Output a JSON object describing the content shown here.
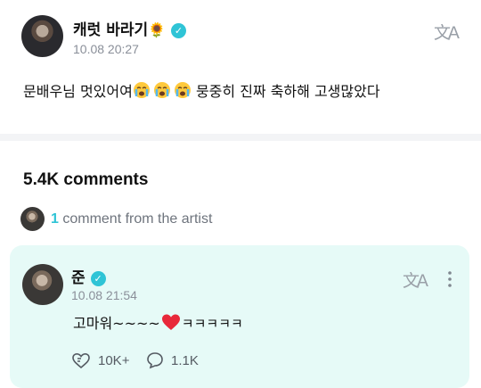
{
  "post": {
    "author_name": "캐럿 바라기",
    "author_emoji": "🌻",
    "timestamp": "10.08 20:27",
    "text_before": "문배우님 멋있어여",
    "text_after": " 뭉중히 진짜 축하해 고생많았다",
    "translate_icon": "文A"
  },
  "comments": {
    "title": "5.4K comments",
    "artist_count": "1",
    "artist_label": " comment from the artist"
  },
  "artist_comment": {
    "name": "준",
    "timestamp": "10.08 21:54",
    "text_before": "고마워~~~~",
    "text_after": "ㅋㅋㅋㅋㅋ",
    "likes": "10K+",
    "replies": "1.1K",
    "translate_icon": "文A",
    "more_icon": "⋮"
  },
  "colors": {
    "accent": "#2fc4d6",
    "card_bg": "#e6faf7",
    "heart": "#e8283a"
  }
}
